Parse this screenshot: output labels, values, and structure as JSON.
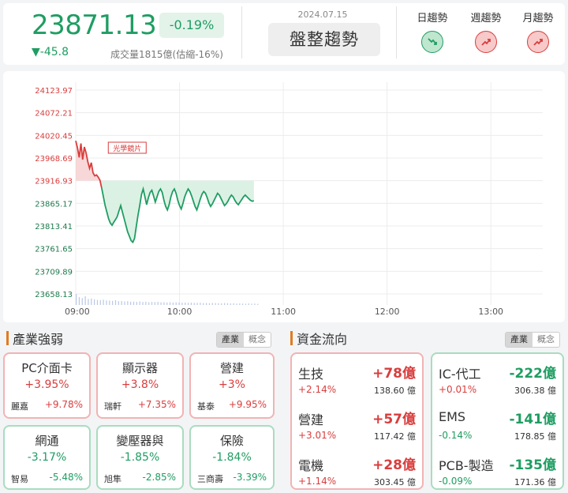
{
  "header": {
    "index_value": "23871.13",
    "change_pct": "-0.19%",
    "change": "▼-45.8",
    "volume": "成交量1815億(估縮-16%)",
    "date": "2024.07.15",
    "trend_label": "盤整趨勢",
    "trends": [
      {
        "label": "日趨勢",
        "direction": "down",
        "icon": "trend-down-icon"
      },
      {
        "label": "週趨勢",
        "direction": "up",
        "icon": "trend-up-icon"
      },
      {
        "label": "月趨勢",
        "direction": "up",
        "icon": "trend-up-icon"
      }
    ],
    "colors": {
      "up": "#d93d3d",
      "down": "#1f9d62"
    }
  },
  "chart_data": {
    "type": "line",
    "y_ticks": [
      "24123.97",
      "24072.21",
      "24020.45",
      "23968.69",
      "23916.93",
      "23865.17",
      "23813.41",
      "23761.65",
      "23709.89",
      "23658.13"
    ],
    "x_ticks": [
      "09:00",
      "10:00",
      "11:00",
      "12:00",
      "13:00"
    ],
    "ylim": [
      23658.13,
      24123.97
    ],
    "reference": 23916.93,
    "annotation": {
      "label": "光學鏡片",
      "time": 34
    },
    "series": [
      {
        "x": [
          0,
          2,
          4,
          6,
          8,
          10,
          12,
          14,
          16,
          18,
          20,
          22,
          24,
          26,
          28,
          30,
          32,
          34,
          36,
          38,
          40,
          42,
          44,
          46,
          48,
          50,
          52,
          54,
          56,
          58,
          60,
          62,
          64,
          66,
          68,
          70,
          72,
          74,
          76,
          78,
          80,
          82,
          84,
          86,
          88,
          90,
          92,
          94,
          96,
          98,
          100,
          102,
          104,
          106,
          108,
          110,
          112,
          114,
          116,
          118,
          120,
          122,
          124,
          126,
          128,
          130,
          132,
          134,
          136,
          138,
          140,
          142,
          144,
          146,
          148,
          150,
          152,
          154,
          156,
          158,
          160,
          162,
          164,
          166,
          168,
          170,
          172,
          174,
          176,
          178,
          180,
          182,
          184,
          186,
          188,
          190,
          192,
          194,
          196,
          198,
          200,
          202,
          204,
          206
        ],
        "y": [
          24008,
          23992,
          23970,
          24002,
          23965,
          23994,
          23980,
          23960,
          23945,
          23958,
          23935,
          23928,
          23930,
          23925,
          23918,
          23900,
          23880,
          23860,
          23845,
          23830,
          23820,
          23815,
          23822,
          23828,
          23835,
          23848,
          23860,
          23845,
          23830,
          23815,
          23800,
          23790,
          23780,
          23776,
          23785,
          23812,
          23838,
          23860,
          23885,
          23898,
          23880,
          23862,
          23878,
          23890,
          23895,
          23882,
          23868,
          23880,
          23892,
          23898,
          23890,
          23872,
          23858,
          23850,
          23862,
          23880,
          23892,
          23898,
          23888,
          23872,
          23860,
          23852,
          23865,
          23880,
          23890,
          23898,
          23892,
          23882,
          23870,
          23858,
          23850,
          23862,
          23875,
          23886,
          23892,
          23888,
          23878,
          23866,
          23858,
          23864,
          23872,
          23880,
          23888,
          23884,
          23876,
          23868,
          23860,
          23864,
          23870,
          23878,
          23884,
          23880,
          23872,
          23866,
          23862,
          23868,
          23874,
          23880,
          23884,
          23880,
          23876,
          23872,
          23870,
          23871
        ]
      }
    ],
    "volume": [
      88,
      62,
      55,
      70,
      48,
      52,
      45,
      40,
      38,
      42,
      36,
      35,
      33,
      38,
      30,
      32,
      28,
      30,
      26,
      27,
      25,
      28,
      24,
      26,
      22,
      24,
      23,
      25,
      21,
      22,
      20,
      22,
      19,
      21,
      20,
      18,
      19,
      17,
      18,
      16,
      17,
      18,
      15,
      16,
      14,
      16,
      15,
      14,
      13,
      15,
      14,
      12,
      13,
      11,
      12,
      11,
      10,
      12,
      10,
      11,
      9
    ]
  },
  "industry": {
    "title": "產業強弱",
    "tabs": [
      "產業",
      "概念"
    ],
    "cards": [
      {
        "name": "PC介面卡",
        "pct": "+3.95%",
        "stock": "麗嘉",
        "stock_pct": "+9.78%",
        "dir": "up"
      },
      {
        "name": "顯示器",
        "pct": "+3.8%",
        "stock": "瑞軒",
        "stock_pct": "+7.35%",
        "dir": "up"
      },
      {
        "name": "營建",
        "pct": "+3%",
        "stock": "基泰",
        "stock_pct": "+9.95%",
        "dir": "up"
      },
      {
        "name": "網通",
        "pct": "-3.17%",
        "stock": "智易",
        "stock_pct": "-5.48%",
        "dir": "dn"
      },
      {
        "name": "變壓器與",
        "pct": "-1.85%",
        "stock": "旭隼",
        "stock_pct": "-2.85%",
        "dir": "dn"
      },
      {
        "name": "保險",
        "pct": "-1.84%",
        "stock": "三商壽",
        "stock_pct": "-3.39%",
        "dir": "dn"
      }
    ]
  },
  "fund_flow": {
    "title": "資金流向",
    "tabs": [
      "產業",
      "概念"
    ],
    "inflow": [
      {
        "name": "生技",
        "amount": "+78億",
        "pct": "+2.14%",
        "value": "138.60 億"
      },
      {
        "name": "營建",
        "amount": "+57億",
        "pct": "+3.01%",
        "value": "117.42 億"
      },
      {
        "name": "電機",
        "amount": "+28億",
        "pct": "+1.14%",
        "value": "303.45 億"
      }
    ],
    "outflow": [
      {
        "name": "IC-代工",
        "amount": "-222億",
        "pct": "+0.01%",
        "value": "306.38 億"
      },
      {
        "name": "EMS",
        "amount": "-141億",
        "pct": "-0.14%",
        "value": "178.85 億"
      },
      {
        "name": "PCB-製造",
        "amount": "-135億",
        "pct": "-0.09%",
        "value": "171.36 億"
      }
    ]
  }
}
